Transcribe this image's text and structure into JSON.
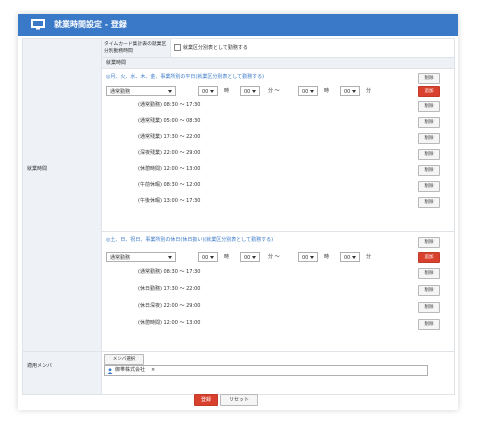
{
  "header": {
    "title": "就業時間設定 - 登録"
  },
  "form": {
    "label_work_hours": "就業時間",
    "label_members": "適用メンバ",
    "timecard_label": "タイムカード集計表の就業区分別勤務時間",
    "timecard_checkbox": "就業区分別表として勤務する",
    "section_label": "就業時間"
  },
  "weekday": {
    "title": "◎月、火、水、木、金、事業所別の平日(就業区分別表として勤務する)",
    "delete_label": "削除",
    "add_label": "追加",
    "category_select": "通常勤務",
    "from_hour": "00",
    "from_min": "00",
    "to_hour": "00",
    "to_min": "00",
    "unit_hour": "時",
    "unit_min": "分 ～",
    "unit_hour2": "時",
    "unit_min2": "分",
    "entries": [
      {
        "text": "(通常勤務) 08:30 ～ 17:30",
        "btn": "削除"
      },
      {
        "text": "(通常残業) 05:00 ～ 08:30",
        "btn": "削除"
      },
      {
        "text": "(通常残業) 17:30 ～ 22:00",
        "btn": "削除"
      },
      {
        "text": "(深夜残業) 22:00 ～ 29:00",
        "btn": "削除"
      },
      {
        "text": "(休憩時間) 12:00 ～ 13:00",
        "btn": "削除"
      },
      {
        "text": "(午前休暇) 08:30 ～ 12:00",
        "btn": "削除"
      },
      {
        "text": "(午後休暇) 13:00 ～ 17:30",
        "btn": "削除"
      }
    ]
  },
  "holiday": {
    "title": "◎土、日、祝日、事業所別の休日(休日扱い)(就業区分別表として勤務する)",
    "delete_label": "削除",
    "add_label": "追加",
    "category_select": "通常勤務",
    "from_hour": "00",
    "from_min": "00",
    "to_hour": "00",
    "to_min": "00",
    "unit_hour": "時",
    "unit_min": "分 ～",
    "unit_hour2": "時",
    "unit_min2": "分",
    "entries": [
      {
        "text": "(通常勤務) 08:30 ～ 17:30",
        "btn": "削除"
      },
      {
        "text": "(休日勤務) 17:30 ～ 22:00",
        "btn": "削除"
      },
      {
        "text": "(休日深夜) 22:00 ～ 29:00",
        "btn": "削除"
      },
      {
        "text": "(休憩時間) 12:00 ～ 13:00",
        "btn": "削除"
      }
    ]
  },
  "members": {
    "select_button": "メンバ選択",
    "tag": "御帯株式会社",
    "remove": "×"
  },
  "footer": {
    "submit": "登録",
    "reset": "リセット"
  },
  "colors": {
    "header_blue": "#3a79c7",
    "add_red": "#d9412e"
  }
}
